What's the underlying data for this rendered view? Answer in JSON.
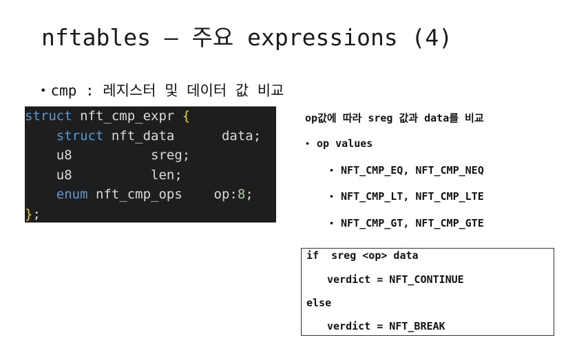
{
  "slide": {
    "title": "nftables – 주요 expressions (4)",
    "bullet_bullet": "•",
    "bullet_text": "cmp : 레지스터 및 데이터 값 비교"
  },
  "code": {
    "lines": [
      [
        "struct",
        " nft_cmp_expr ",
        "{"
      ],
      [
        "    ",
        "struct",
        " nft_data      data;"
      ],
      [
        "    u8          sreg;"
      ],
      [
        "    u8          len;"
      ],
      [
        "    ",
        "enum",
        " nft_cmp_ops    op:",
        "8",
        ";"
      ],
      [
        "}",
        ";"
      ]
    ]
  },
  "right": {
    "description": "op값에 따라 sreg 값과 data를 비교",
    "op_values_label": "op values",
    "op_values": [
      "NFT_CMP_EQ, NFT_CMP_NEQ",
      "NFT_CMP_LT, NFT_CMP_LTE",
      "NFT_CMP_GT, NFT_CMP_GTE"
    ],
    "bullet": "•"
  },
  "box": {
    "line1": "if  sreg <op> data",
    "line2": "verdict = NFT_CONTINUE",
    "line3": "else",
    "line4": "verdict = NFT_BREAK"
  }
}
